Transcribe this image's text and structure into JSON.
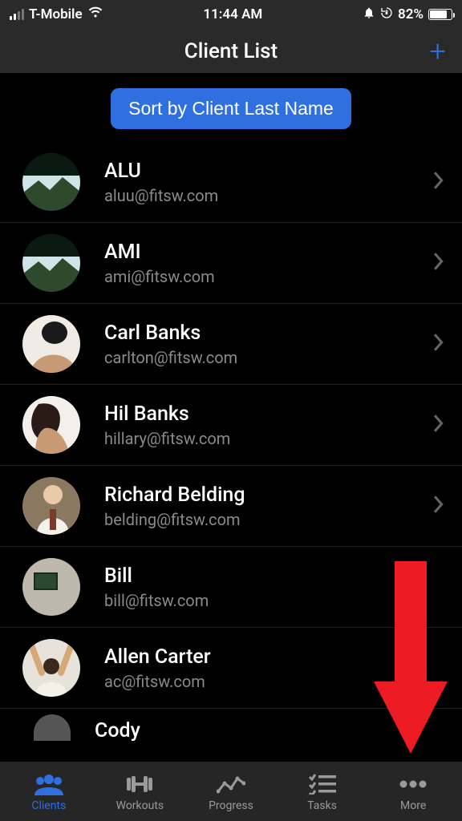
{
  "status": {
    "carrier": "T-Mobile",
    "time": "11:44 AM",
    "battery_pct": "82%"
  },
  "nav": {
    "title": "Client List",
    "add_symbol": "+"
  },
  "sort": {
    "label": "Sort by Client Last Name"
  },
  "clients": [
    {
      "name": "ALU",
      "email": "aluu@fitsw.com",
      "avatar": "landscape"
    },
    {
      "name": "AMI",
      "email": "ami@fitsw.com",
      "avatar": "landscape"
    },
    {
      "name": "Carl Banks",
      "email": "carlton@fitsw.com",
      "avatar": "person1"
    },
    {
      "name": "Hil Banks",
      "email": "hillary@fitsw.com",
      "avatar": "person2"
    },
    {
      "name": "Richard Belding",
      "email": "belding@fitsw.com",
      "avatar": "person3"
    },
    {
      "name": "Bill",
      "email": "bill@fitsw.com",
      "avatar": "room"
    },
    {
      "name": "Allen Carter",
      "email": "ac@fitsw.com",
      "avatar": "person4"
    },
    {
      "name": "Cody",
      "email": "",
      "avatar": "blank"
    }
  ],
  "tabs": [
    {
      "label": "Clients",
      "active": true
    },
    {
      "label": "Workouts",
      "active": false
    },
    {
      "label": "Progress",
      "active": false
    },
    {
      "label": "Tasks",
      "active": false
    },
    {
      "label": "More",
      "active": false
    }
  ],
  "colors": {
    "accent": "#2f6fe0",
    "arrow": "#ed1c24"
  }
}
